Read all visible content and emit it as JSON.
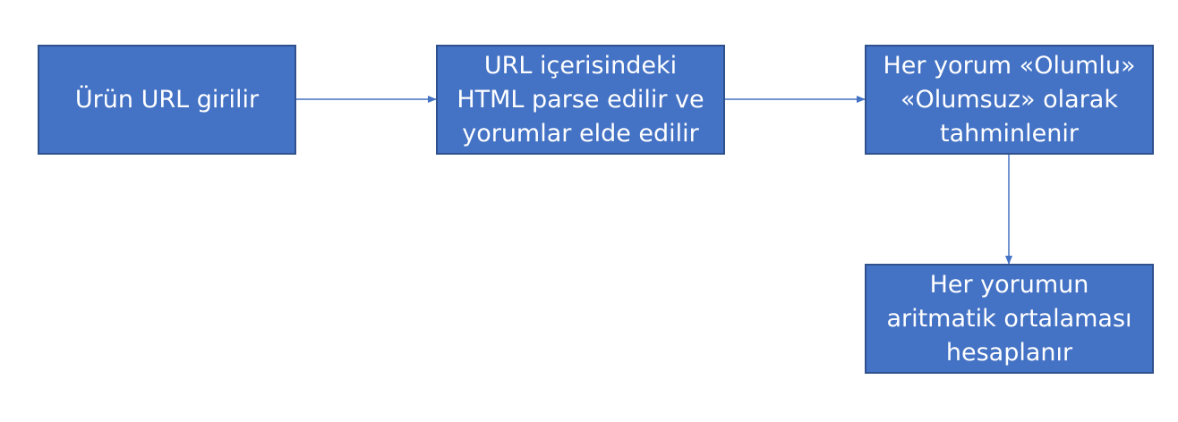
{
  "nodes": [
    {
      "id": "n1",
      "label": "Ürün URL girilir"
    },
    {
      "id": "n2",
      "label": "URL içerisindeki\nHTML parse edilir ve\nyorumlar elde edilir"
    },
    {
      "id": "n3",
      "label": "Her yorum «Olumlu»\n«Olumsuz» olarak\ntahminlenir"
    },
    {
      "id": "n4",
      "label": "Her yorumun\naritmatik ortalaması\nhesaplanır"
    }
  ],
  "edges": [
    {
      "from": "n1",
      "to": "n2"
    },
    {
      "from": "n2",
      "to": "n3"
    },
    {
      "from": "n3",
      "to": "n4"
    }
  ],
  "colors": {
    "node_fill": "#4472c4",
    "node_border": "#2f528f",
    "node_text": "#ffffff",
    "connector": "#4472c4"
  }
}
